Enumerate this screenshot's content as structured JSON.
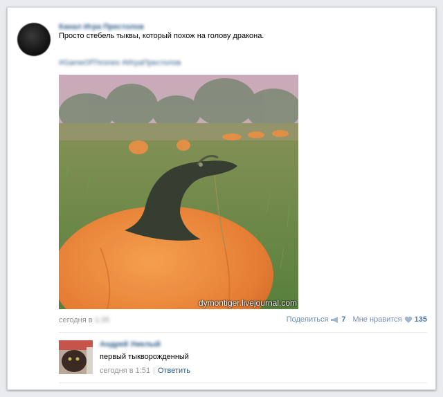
{
  "post": {
    "author": "Канал Игра Престолов",
    "text": "Просто стебель тыквы, который похож на голову дракона.",
    "hashtags": "#GameOfThrones #ИграПрестолов",
    "photo_watermark": "dymontiger.livejournal.com",
    "date_prefix": "сегодня в",
    "date_time": "1:35",
    "share_label": "Поделиться",
    "share_count": "7",
    "like_label": "Мне нравится",
    "like_count": "135"
  },
  "comment": {
    "author": "Андрей Умелый",
    "text": "первый тыкворожденный",
    "date": "сегодня в 1:51",
    "reply_label": "Ответить"
  },
  "colors": {
    "link": "#2a5885",
    "meta": "#939393",
    "pumpkin": "#e8792a"
  }
}
